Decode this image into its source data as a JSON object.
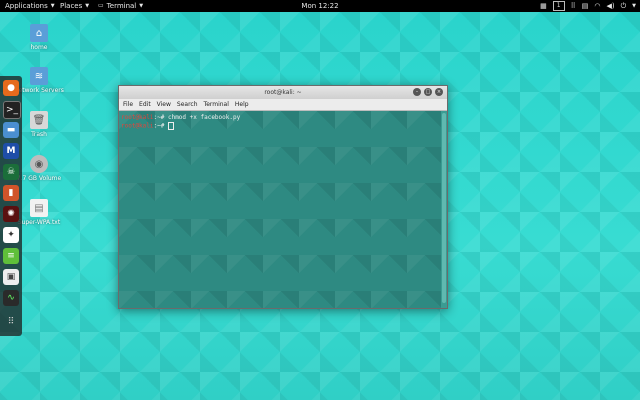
{
  "topbar": {
    "applications": "Applications",
    "places": "Places",
    "terminal": "Terminal",
    "clock": "Mon 12:22",
    "workspace": "1"
  },
  "desktop": {
    "icons": [
      {
        "label": "home",
        "icon": "folder-home-icon"
      },
      {
        "label": "Network Servers",
        "icon": "network-folder-icon"
      },
      {
        "label": "Trash",
        "icon": "trash-icon"
      },
      {
        "label": "7.7 GB Volume",
        "icon": "drive-icon"
      },
      {
        "label": "Super-WPA.txt",
        "icon": "text-file-icon"
      }
    ]
  },
  "window": {
    "title": "root@kali: ~",
    "menu": [
      "File",
      "Edit",
      "View",
      "Search",
      "Terminal",
      "Help"
    ],
    "terminal": {
      "prompt": "root@kali",
      "line1_rest": ":~# chmod +x facebook.py",
      "line2_rest": ":~# "
    }
  },
  "colors": {
    "wallpaper": "#2fd0c8",
    "terminal_bg": "#2e8a82",
    "prompt": "#e2453c"
  }
}
